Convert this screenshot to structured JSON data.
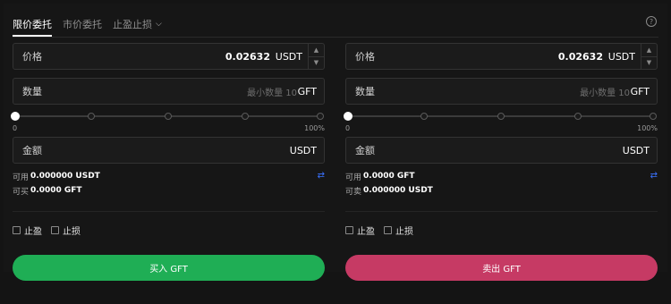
{
  "tabs": [
    {
      "label": "限价委托"
    },
    {
      "label": "市价委托"
    },
    {
      "label": "止盈止损"
    }
  ],
  "help_icon": "?",
  "buy": {
    "price_label": "价格",
    "price_value": "0.02632",
    "price_unit": "USDT",
    "qty_label": "数量",
    "qty_placeholder": "最小数量 10",
    "qty_unit": "GFT",
    "slider_min": "0",
    "slider_max": "100%",
    "slider_value": 0,
    "amount_label": "金额",
    "amount_unit": "USDT",
    "available_label": "可用",
    "available_value": "0.000000 USDT",
    "can_label": "可买",
    "can_value": "0.0000 GFT",
    "tp_label": "止盈",
    "sl_label": "止损",
    "action_label": "买入 GFT"
  },
  "sell": {
    "price_label": "价格",
    "price_value": "0.02632",
    "price_unit": "USDT",
    "qty_label": "数量",
    "qty_placeholder": "最小数量 10",
    "qty_unit": "GFT",
    "slider_min": "0",
    "slider_max": "100%",
    "slider_value": 0,
    "amount_label": "金额",
    "amount_unit": "USDT",
    "available_label": "可用",
    "available_value": "0.0000 GFT",
    "can_label": "可卖",
    "can_value": "0.000000 USDT",
    "tp_label": "止盈",
    "sl_label": "止损",
    "action_label": "卖出 GFT"
  },
  "colors": {
    "buy": "#1fae55",
    "sell": "#c63a64",
    "swap_icon": "#3a72ff"
  },
  "icons": {
    "help": "help-icon",
    "swap": "swap-icon",
    "stepper_up": "chevron-up-icon",
    "stepper_down": "chevron-down-icon",
    "dropdown": "chevron-down-icon"
  }
}
